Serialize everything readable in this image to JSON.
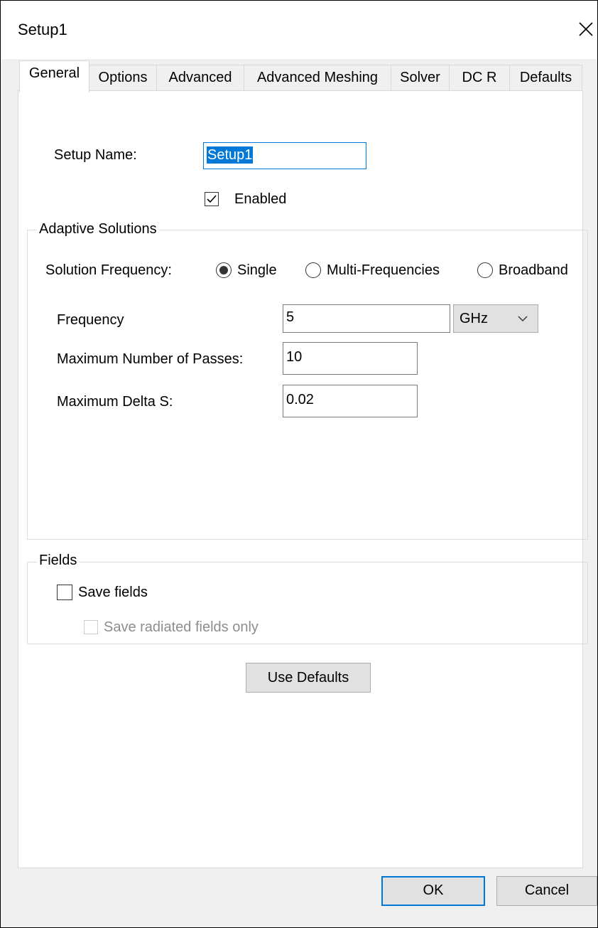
{
  "window": {
    "title": "Setup1"
  },
  "tabs": [
    {
      "label": "General",
      "active": true
    },
    {
      "label": "Options",
      "active": false
    },
    {
      "label": "Advanced",
      "active": false
    },
    {
      "label": "Advanced Meshing",
      "active": false
    },
    {
      "label": "Solver",
      "active": false
    },
    {
      "label": "DC R",
      "active": false
    },
    {
      "label": "Defaults",
      "active": false
    }
  ],
  "general": {
    "setup_name_label": "Setup Name:",
    "setup_name_value": "Setup1",
    "enabled_label": "Enabled",
    "enabled_checked": true
  },
  "adaptive": {
    "group_title": "Adaptive Solutions",
    "solution_frequency_label": "Solution Frequency:",
    "options": [
      {
        "label": "Single",
        "selected": true
      },
      {
        "label": "Multi-Frequencies",
        "selected": false
      },
      {
        "label": "Broadband",
        "selected": false
      }
    ],
    "frequency_label": "Frequency",
    "frequency_value": "5",
    "frequency_unit": "GHz",
    "max_passes_label": "Maximum Number of Passes:",
    "max_passes_value": "10",
    "max_delta_s_label": "Maximum Delta S:",
    "max_delta_s_value": "0.02"
  },
  "fields": {
    "group_title": "Fields",
    "save_fields_label": "Save fields",
    "save_fields_checked": false,
    "save_radiated_label": "Save radiated fields only",
    "save_radiated_checked": false,
    "save_radiated_enabled": false
  },
  "buttons": {
    "use_defaults": "Use Defaults",
    "ok": "OK",
    "cancel": "Cancel"
  },
  "colors": {
    "accent": "#0078d7",
    "dialog_bg": "#f0f0f0",
    "button_bg": "#e1e1e1"
  }
}
